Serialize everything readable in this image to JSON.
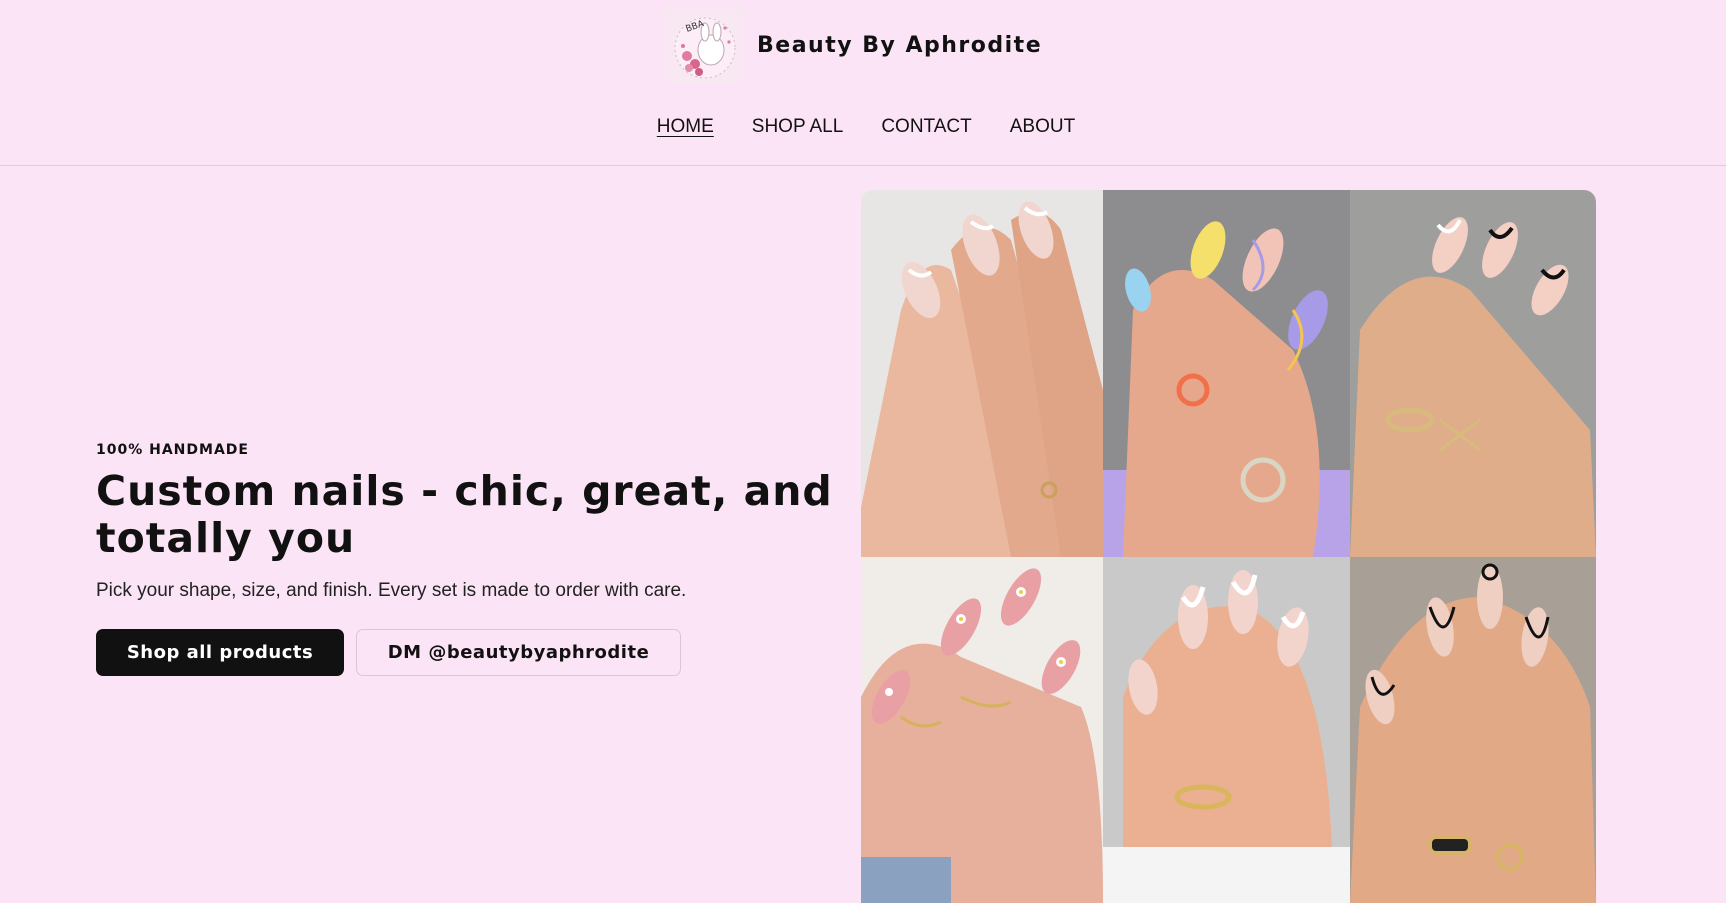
{
  "site": {
    "brand_name": "Beauty By Aphrodite",
    "logo_text": "BBA"
  },
  "nav": {
    "items": [
      {
        "label": "HOME",
        "active": true
      },
      {
        "label": "SHOP ALL",
        "active": false
      },
      {
        "label": "CONTACT",
        "active": false
      },
      {
        "label": "ABOUT",
        "active": false
      }
    ]
  },
  "hero": {
    "eyebrow": "100% HANDMADE",
    "headline": "Custom nails - chic, great, and totally you",
    "subtext": "Pick your shape, size, and finish. Every set is made to order with care.",
    "primary_button": "Shop all products",
    "secondary_button": "DM @beautybyaphrodite"
  },
  "gallery": {
    "images": [
      {
        "name": "nail-photo-white-swirl-almond"
      },
      {
        "name": "nail-photo-pastel-swirl"
      },
      {
        "name": "nail-photo-black-french-tips"
      },
      {
        "name": "nail-photo-daisy-pink"
      },
      {
        "name": "nail-photo-white-wave-square"
      },
      {
        "name": "nail-photo-black-swirl-almond"
      }
    ]
  },
  "colors": {
    "background": "#fce4f7",
    "primary_button": "#111111",
    "text": "#111111"
  }
}
